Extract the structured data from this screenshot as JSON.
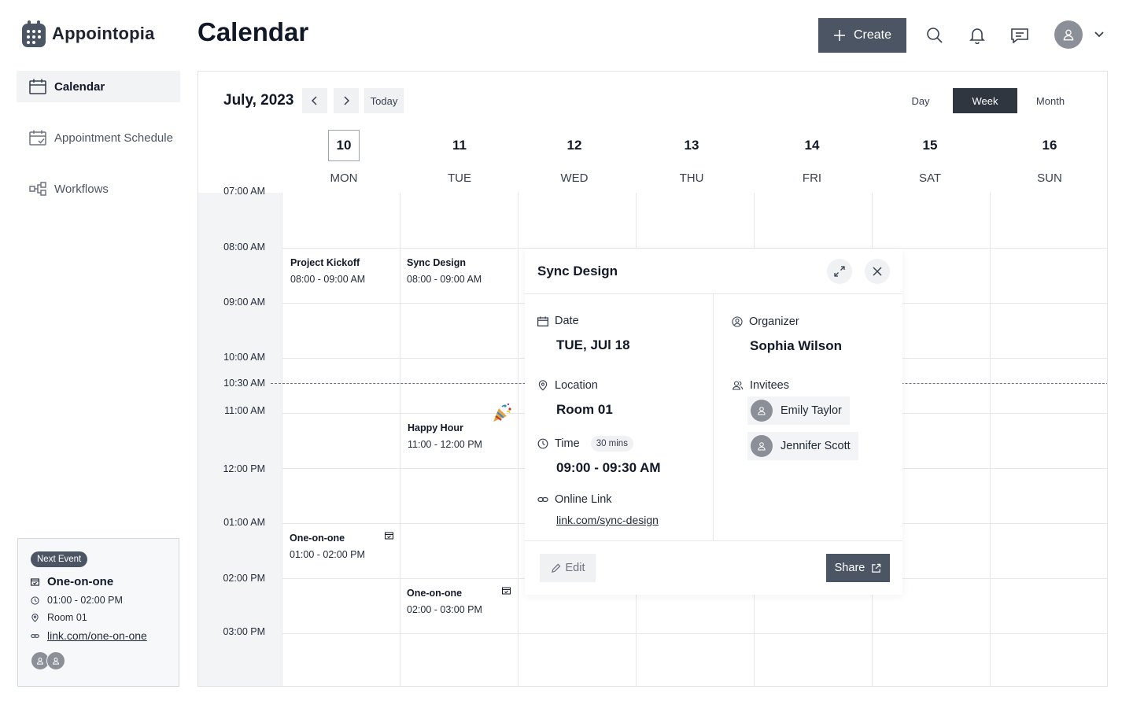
{
  "app": {
    "name": "Appointopia",
    "page_title": "Calendar"
  },
  "sidebar": {
    "items": [
      {
        "label": "Calendar",
        "icon": "calendar-icon",
        "active": true
      },
      {
        "label": "Appointment Schedule",
        "icon": "calendar-check-icon",
        "active": false
      },
      {
        "label": "Workflows",
        "icon": "workflow-icon",
        "active": false
      }
    ],
    "next_event": {
      "badge": "Next Event",
      "title": "One-on-one",
      "time": "01:00 - 02:00 PM",
      "location": "Room 01",
      "link": "link.com/one-on-one"
    }
  },
  "header": {
    "create_label": "Create",
    "icons": [
      "search-icon",
      "bell-icon",
      "message-icon"
    ]
  },
  "calendar": {
    "month_label": "July, 2023",
    "today_label": "Today",
    "views": [
      "Day",
      "Week",
      "Month"
    ],
    "active_view": "Week",
    "days": [
      {
        "num": "10",
        "name": "MON",
        "today": true
      },
      {
        "num": "11",
        "name": "TUE"
      },
      {
        "num": "12",
        "name": "WED"
      },
      {
        "num": "13",
        "name": "THU"
      },
      {
        "num": "14",
        "name": "FRI"
      },
      {
        "num": "15",
        "name": "SAT"
      },
      {
        "num": "16",
        "name": "SUN"
      }
    ],
    "time_labels": [
      "07:00 AM",
      "08:00 AM",
      "09:00 AM",
      "10:00 AM",
      "10:30 AM",
      "11:00 AM",
      "12:00 PM",
      "01:00 AM",
      "02:00 PM",
      "03:00 PM"
    ],
    "events": [
      {
        "title": "Project Kickoff",
        "time": "08:00 - 09:00 AM",
        "day": "MON"
      },
      {
        "title": "Sync Design",
        "time": "08:00 - 09:00 AM",
        "day": "TUE"
      },
      {
        "title": "Happy Hour",
        "time": "11:00 - 12:00 PM",
        "day": "TUE"
      },
      {
        "title": "One-on-one",
        "time": "01:00 - 02:00 PM",
        "day": "MON"
      },
      {
        "title": "One-on-one",
        "time": "02:00 - 03:00 PM",
        "day": "TUE"
      }
    ]
  },
  "popover": {
    "title": "Sync Design",
    "date_label": "Date",
    "date_value": "TUE, JUl 18",
    "location_label": "Location",
    "location_value": "Room 01",
    "time_label": "Time",
    "duration": "30 mins",
    "time_value": "09:00 - 09:30 AM",
    "link_label": "Online Link",
    "link_value": "link.com/sync-design",
    "organizer_label": "Organizer",
    "organizer_value": "Sophia Wilson",
    "invitees_label": "Invitees",
    "invitees": [
      "Emily Taylor",
      "Jennifer Scott"
    ],
    "edit_label": "Edit",
    "share_label": "Share"
  },
  "colors": {
    "primary": "#4b5563",
    "active_view": "#2f3640",
    "panel_bg": "#f3f4f6"
  }
}
